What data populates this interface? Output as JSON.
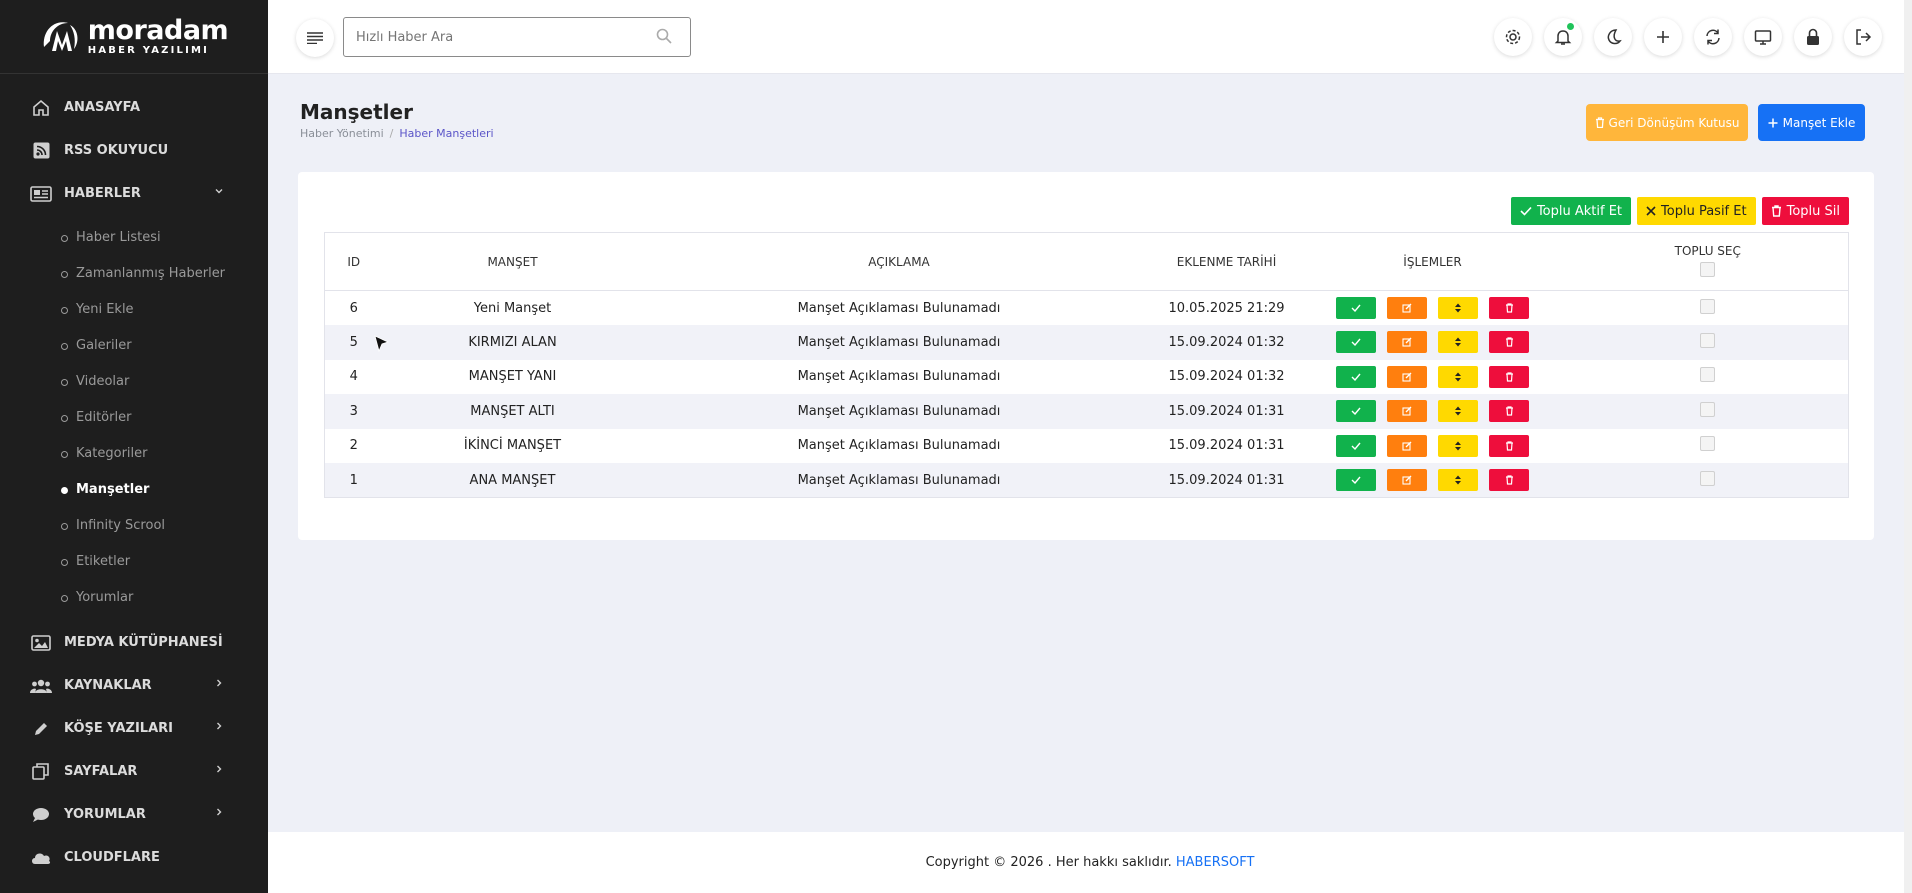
{
  "brand": {
    "logo_main": "moradam",
    "logo_sub": "HABER YAZILIMI"
  },
  "sidebar": {
    "items": [
      {
        "label": "ANASAYFA",
        "icon": "home-icon"
      },
      {
        "label": "RSS OKUYUCU",
        "icon": "rss-icon"
      },
      {
        "label": "HABERLER",
        "icon": "newspaper-icon",
        "expanded": true
      },
      {
        "label": "MEDYA KÜTÜPHANESİ",
        "icon": "image-icon"
      },
      {
        "label": "KAYNAKLAR",
        "icon": "users-icon"
      },
      {
        "label": "KÖŞE YAZILARI",
        "icon": "pen-icon"
      },
      {
        "label": "SAYFALAR",
        "icon": "pages-icon"
      },
      {
        "label": "YORUMLAR",
        "icon": "comment-icon"
      },
      {
        "label": "CLOUDFLARE",
        "icon": "cloud-icon"
      }
    ],
    "haberler_sub": [
      "Haber Listesi",
      "Zamanlanmış Haberler",
      "Yeni Ekle",
      "Galeriler",
      "Videolar",
      "Editörler",
      "Kategoriler",
      "Manşetler",
      "Infinity Scrool",
      "Etiketler",
      "Yorumlar"
    ],
    "active_sub": "Manşetler"
  },
  "topbar": {
    "search_placeholder": "Hızlı Haber Ara"
  },
  "page": {
    "title": "Manşetler",
    "breadcrumb": [
      "Haber Yönetimi",
      "Haber Manşetleri"
    ],
    "recycle_label": "Geri Dönüşüm Kutusu",
    "add_label": "Manşet Ekle"
  },
  "bulk": {
    "activate": "Toplu Aktif Et",
    "deactivate": "Toplu Pasif Et",
    "delete": "Toplu Sil"
  },
  "table": {
    "headers": [
      "ID",
      "MANŞET",
      "AÇIKLAMA",
      "EKLENME TARİHİ",
      "İŞLEMLER",
      "TOPLU SEÇ"
    ],
    "rows": [
      {
        "id": "6",
        "title": "Yeni Manşet",
        "desc": "Manşet Açıklaması Bulunamadı",
        "date": "10.05.2025 21:29"
      },
      {
        "id": "5",
        "title": "KIRMIZI ALAN",
        "desc": "Manşet Açıklaması Bulunamadı",
        "date": "15.09.2024 01:32"
      },
      {
        "id": "4",
        "title": "MANŞET YANI",
        "desc": "Manşet Açıklaması Bulunamadı",
        "date": "15.09.2024 01:32"
      },
      {
        "id": "3",
        "title": "MANŞET ALTI",
        "desc": "Manşet Açıklaması Bulunamadı",
        "date": "15.09.2024 01:31"
      },
      {
        "id": "2",
        "title": "İKİNCİ MANŞET",
        "desc": "Manşet Açıklaması Bulunamadı",
        "date": "15.09.2024 01:31"
      },
      {
        "id": "1",
        "title": "ANA MANŞET",
        "desc": "Manşet Açıklaması Bulunamadı",
        "date": "15.09.2024 01:31"
      }
    ]
  },
  "footer": {
    "text": "Copyright © 2026 . Her hakkı saklıdır.",
    "brand": "HABERSOFT"
  },
  "colors": {
    "sidebar_bg": "#1e1e1e",
    "primary": "#1671f5",
    "warning": "#ffb63b",
    "success": "#11b24c",
    "orange": "#ff7f0e",
    "yellow": "#ffd900",
    "danger": "#ee0e3c"
  }
}
